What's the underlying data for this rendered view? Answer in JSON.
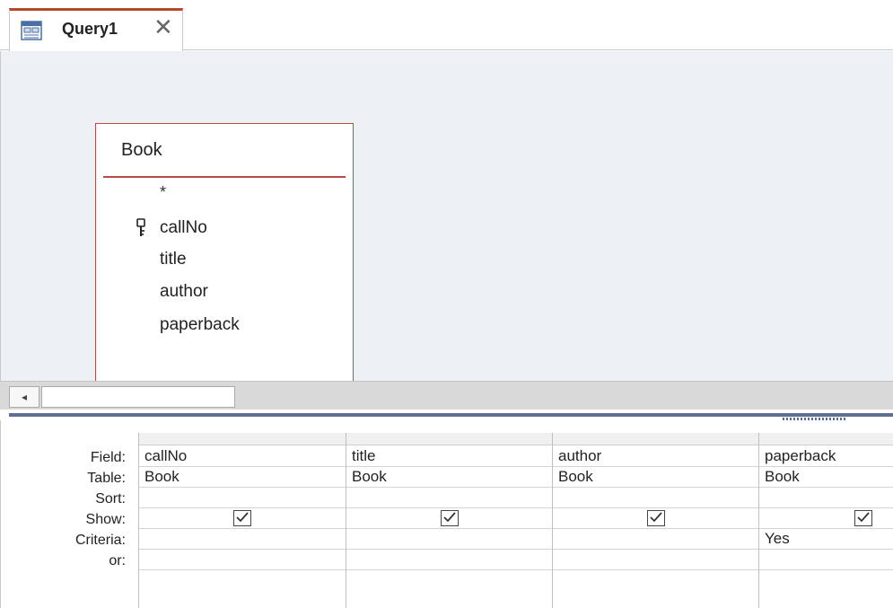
{
  "tab": {
    "label": "Query1",
    "close_glyph": "✕",
    "icon": "query-icon"
  },
  "table_box": {
    "title": "Book",
    "star": "*",
    "fields": [
      "callNo",
      "title",
      "author",
      "paperback"
    ],
    "primary_key_field": "callNo"
  },
  "scrollbar": {
    "left_arrow": "◂"
  },
  "grid": {
    "row_labels": [
      "Field:",
      "Table:",
      "Sort:",
      "Show:",
      "Criteria:",
      "or:"
    ],
    "columns": [
      {
        "field": "callNo",
        "table": "Book",
        "sort": "",
        "show": true,
        "criteria": "",
        "or": ""
      },
      {
        "field": "title",
        "table": "Book",
        "sort": "",
        "show": true,
        "criteria": "",
        "or": ""
      },
      {
        "field": "author",
        "table": "Book",
        "sort": "",
        "show": true,
        "criteria": "",
        "or": ""
      },
      {
        "field": "paperback",
        "table": "Book",
        "sort": "",
        "show": true,
        "criteria": "Yes",
        "or": ""
      }
    ]
  },
  "colors": {
    "accent": "#b7472a",
    "table_border": "#b94a4a",
    "canvas_bg": "#edf0f4",
    "splitter": "#5e6f93"
  }
}
